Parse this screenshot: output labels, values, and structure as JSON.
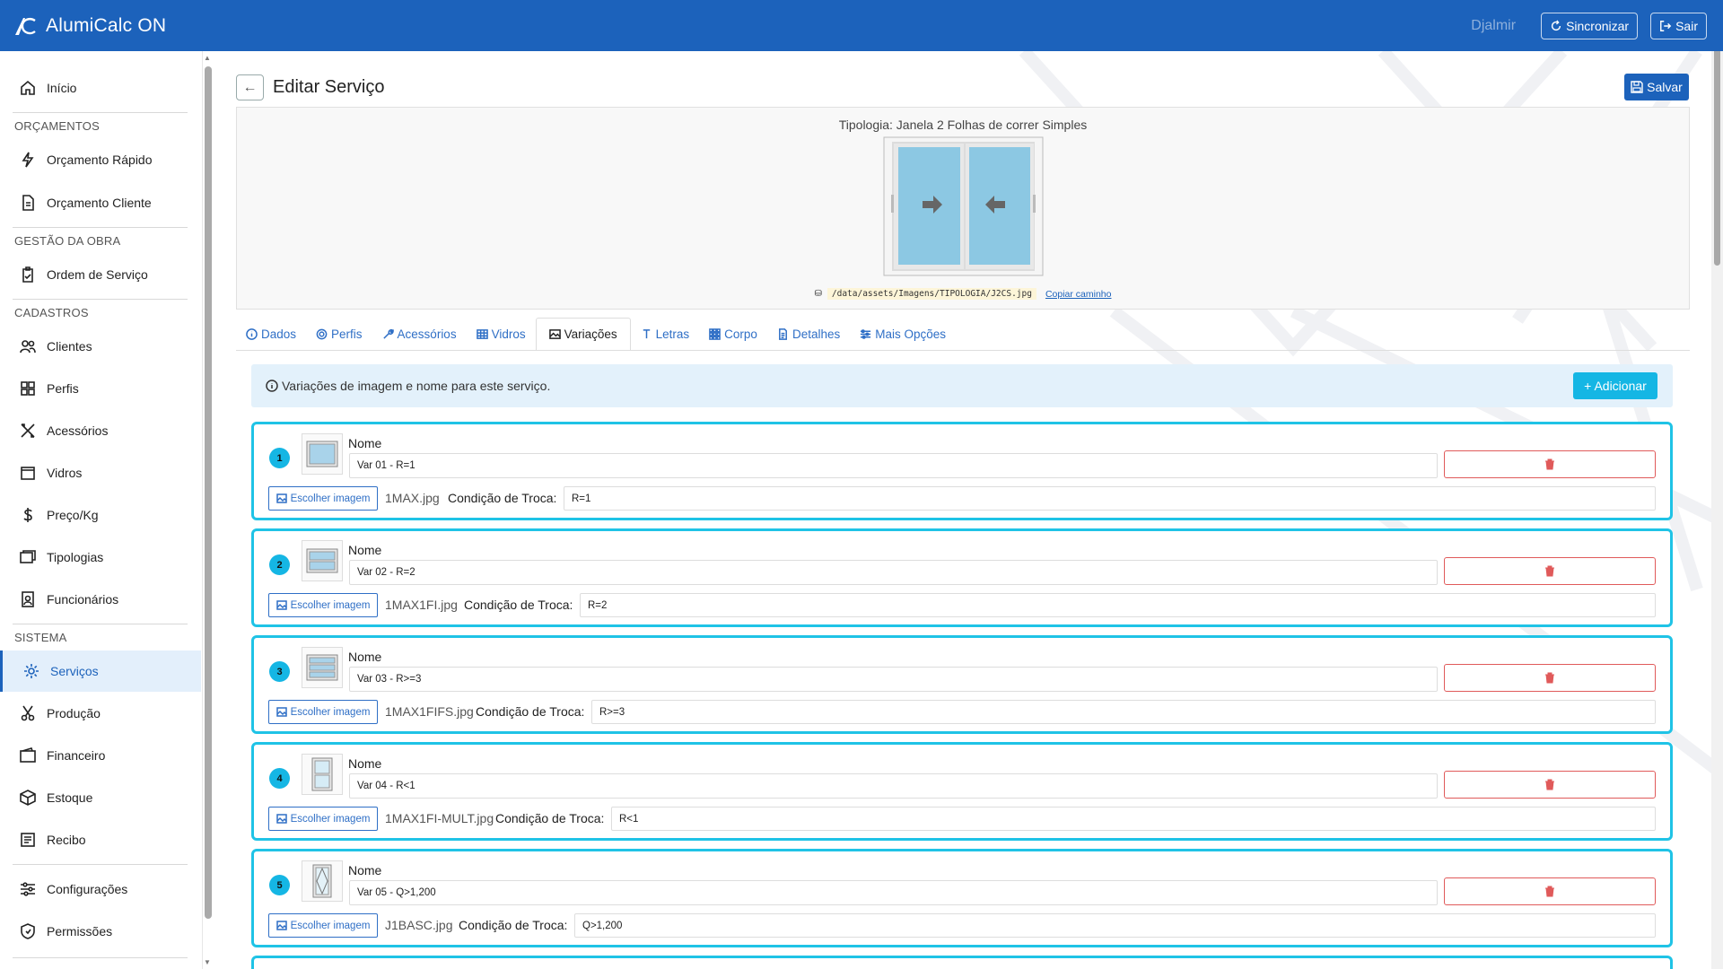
{
  "app": {
    "title": "AlumiCalc ON",
    "user": "Djalmir",
    "sync_label": "Sincronizar",
    "logout_label": "Sair"
  },
  "sidebar": {
    "inicio": "Início",
    "sections": {
      "orcamentos": "ORÇAMENTOS",
      "gestao": "GESTÃO DA OBRA",
      "cadastros": "CADASTROS",
      "sistema": "SISTEMA"
    },
    "items": {
      "orcamento_rapido": "Orçamento Rápido",
      "orcamento_cliente": "Orçamento Cliente",
      "ordem_servico": "Ordem de Serviço",
      "clientes": "Clientes",
      "perfis": "Perfis",
      "acessorios": "Acessórios",
      "vidros": "Vidros",
      "preco_kg": "Preço/Kg",
      "tipologias": "Tipologias",
      "funcionarios": "Funcionários",
      "servicos": "Serviços",
      "producao": "Produção",
      "financeiro": "Financeiro",
      "estoque": "Estoque",
      "recibo": "Recibo",
      "configuracoes": "Configurações",
      "permissoes": "Permissões"
    },
    "active": "servicos"
  },
  "page": {
    "title": "Editar Serviço",
    "save_label": "Salvar",
    "tipologia": "Tipologia: Janela 2 Folhas de correr Simples",
    "image_path": "/data/assets/Imagens/TIPOLOGIA/J2CS.jpg",
    "copy_path_label": "Copiar caminho"
  },
  "tabs": [
    {
      "label": "Dados",
      "icon": "info-icon"
    },
    {
      "label": "Perfis",
      "icon": "gear-icon"
    },
    {
      "label": "Acessórios",
      "icon": "wrench-icon"
    },
    {
      "label": "Vidros",
      "icon": "grid-icon"
    },
    {
      "label": "Variações",
      "icon": "image-icon"
    },
    {
      "label": "Letras",
      "icon": "text-icon"
    },
    {
      "label": "Corpo",
      "icon": "grid-dots-icon"
    },
    {
      "label": "Detalhes",
      "icon": "document-icon"
    },
    {
      "label": "Mais Opções",
      "icon": "sliders-icon"
    }
  ],
  "active_tab": "Variações",
  "variations_info": "Variações de imagem e nome para este serviço.",
  "add_label": "+ Adicionar",
  "labels": {
    "nome": "Nome",
    "escolher_imagem": "Escolher imagem",
    "condicao": "Condição de Troca:"
  },
  "variations": [
    {
      "num": "1",
      "nome": "Var 01 - R=1",
      "file": "1MAX.jpg",
      "condicao": "R=1"
    },
    {
      "num": "2",
      "nome": "Var 02 - R=2",
      "file": "1MAX1FI.jpg",
      "condicao": "R=2"
    },
    {
      "num": "3",
      "nome": "Var 03 - R>=3",
      "file": "1MAX1FIFS.jpg",
      "condicao": "R>=3"
    },
    {
      "num": "4",
      "nome": "Var 04 - R<1",
      "file": "1MAX1FI-MULT.jpg",
      "condicao": "R<1"
    },
    {
      "num": "5",
      "nome": "Var 05 - Q>1,200",
      "file": "J1BASC.jpg",
      "condicao": "Q>1,200"
    }
  ],
  "colors": {
    "primary": "#1c62bb",
    "accent": "#15b6e4",
    "card_border": "#1fc3e6",
    "danger": "#e05a5a"
  }
}
